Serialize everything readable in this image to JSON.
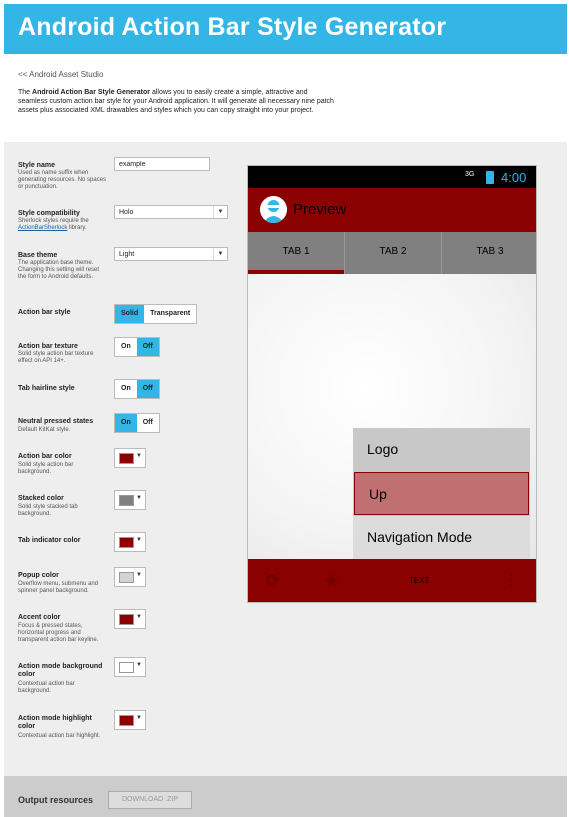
{
  "header": {
    "title": "Android Action Bar Style Generator"
  },
  "nav": {
    "back_link": "<< Android Asset Studio"
  },
  "intro": {
    "prefix": "The ",
    "bold": "Android Action Bar Style Generator",
    "text": " allows you to easily create a simple, attractive and seamless custom action bar style for your Android application. It will generate all necessary nine patch assets plus associated XML drawables and styles which you can copy straight into your project."
  },
  "form": {
    "style_name": {
      "label": "Style name",
      "help": "Used as name suffix when generating resources. No spaces or punctuation.",
      "value": "example"
    },
    "style_compat": {
      "label": "Style compatibility",
      "help_prefix": "Sherlock styles require the ",
      "help_link": "ActionBarSherlock",
      "help_suffix": " library.",
      "value": "Holo"
    },
    "base_theme": {
      "label": "Base theme",
      "help": "The application base theme. Changing this setting will reset the form to Android defaults.",
      "value": "Light"
    },
    "action_bar_style": {
      "label": "Action bar style",
      "opt1": "Solid",
      "opt2": "Transparent"
    },
    "action_bar_texture": {
      "label": "Action bar texture",
      "help": "Solid style action bar texture effect on API 14+.",
      "opt1": "On",
      "opt2": "Off"
    },
    "tab_hairline": {
      "label": "Tab hairline style",
      "opt1": "On",
      "opt2": "Off"
    },
    "neutral_pressed": {
      "label": "Neutral pressed states",
      "help": "Default KitKat style.",
      "opt1": "On",
      "opt2": "Off"
    },
    "action_bar_color": {
      "label": "Action bar color",
      "help": "Solid style action bar background.",
      "color": "#8b0000"
    },
    "stacked_color": {
      "label": "Stacked color",
      "help": "Solid style stacked tab background.",
      "color": "#808080"
    },
    "tab_indicator_color": {
      "label": "Tab indicator color",
      "color": "#8b0000"
    },
    "popup_color": {
      "label": "Popup color",
      "help": "Overflow menu, submenu and spinner panel background.",
      "color": "#d3d3d3"
    },
    "accent_color": {
      "label": "Accent color",
      "help": "Focus & pressed states, horizontal progress and transparent action bar keyline.",
      "color": "#8b0000"
    },
    "action_mode_bg": {
      "label": "Action mode background color",
      "help": "Contextual action bar background.",
      "color": "#ffffff"
    },
    "action_mode_highlight": {
      "label": "Action mode highlight color",
      "help": "Contextual action bar highlight.",
      "color": "#8b0000"
    }
  },
  "preview": {
    "signal": "3G",
    "time": "4:00",
    "title": "Preview",
    "tabs": [
      "TAB 1",
      "TAB 2",
      "TAB 3"
    ],
    "popup_items": [
      "Logo",
      "Up",
      "Navigation Mode"
    ],
    "split_text": "TEXT",
    "icons": {
      "refresh": "refresh-icon",
      "star": "star-icon",
      "overflow": "overflow-icon",
      "logo": "avatar-icon"
    }
  },
  "footer": {
    "label": "Output resources",
    "download": "DOWNLOAD .ZIP"
  }
}
